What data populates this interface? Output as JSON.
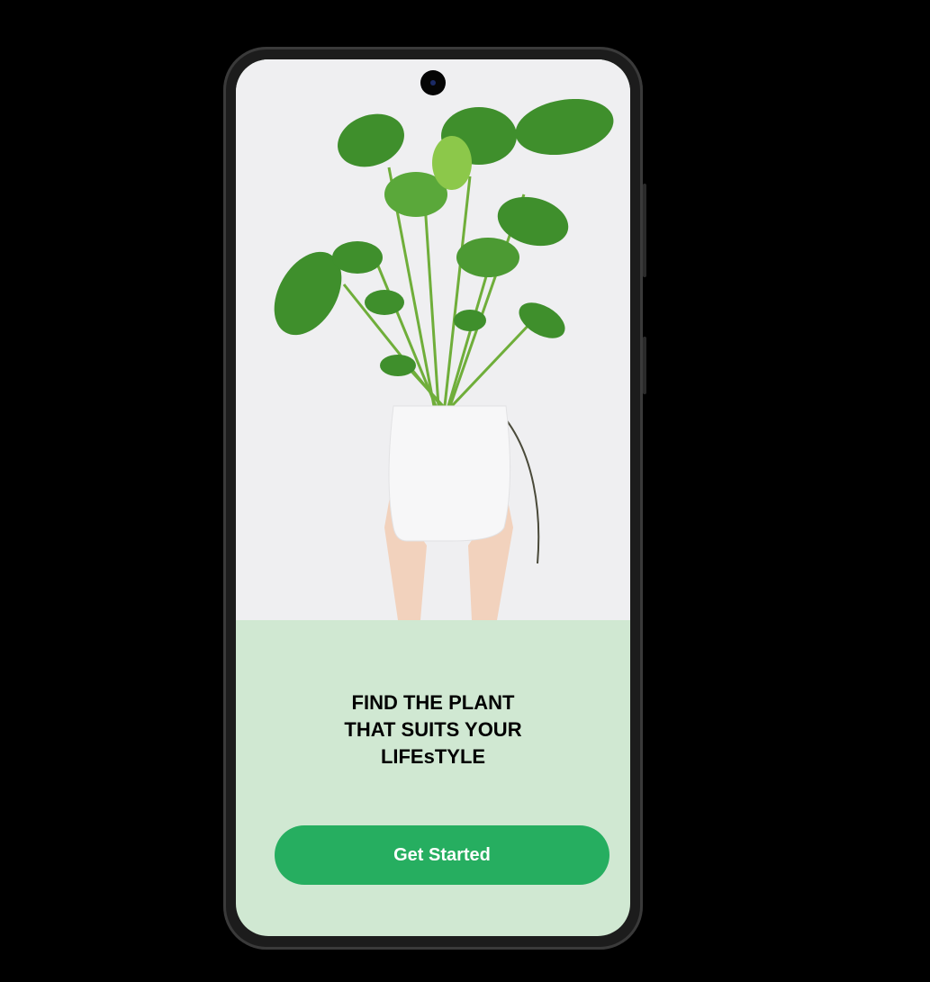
{
  "onboarding": {
    "headline_lines": [
      "FIND THE PLANT",
      "THAT SUITS YOUR",
      "LIFEsTYLE"
    ],
    "cta_label": "Get Started"
  },
  "colors": {
    "panel_bg": "#d0e8d2",
    "button_bg": "#26ae60",
    "button_text": "#ffffff"
  },
  "icons": {
    "camera": "front-camera-icon"
  }
}
